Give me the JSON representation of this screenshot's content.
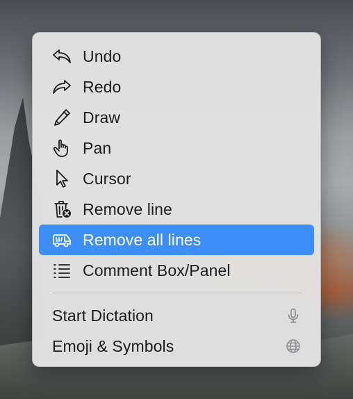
{
  "menu": {
    "items": [
      {
        "label": "Undo",
        "icon": "undo-arrow-icon",
        "selected": false
      },
      {
        "label": "Redo",
        "icon": "redo-arrow-icon",
        "selected": false
      },
      {
        "label": "Draw",
        "icon": "pencil-icon",
        "selected": false
      },
      {
        "label": "Pan",
        "icon": "hand-pointer-icon",
        "selected": false
      },
      {
        "label": "Cursor",
        "icon": "cursor-arrow-icon",
        "selected": false
      },
      {
        "label": "Remove line",
        "icon": "trash-remove-icon",
        "selected": false
      },
      {
        "label": "Remove all lines",
        "icon": "truck-remove-all-icon",
        "selected": true
      },
      {
        "label": "Comment Box/Panel",
        "icon": "list-bullets-icon",
        "selected": false
      }
    ],
    "system_items": [
      {
        "label": "Start Dictation",
        "trailing_icon": "microphone-icon"
      },
      {
        "label": "Emoji & Symbols",
        "trailing_icon": "globe-icon"
      }
    ]
  },
  "colors": {
    "menu_background": "#e2e2e2",
    "selection": "#3d8ef8",
    "text": "#1c1c1e",
    "trailing_icon": "#8e8e93"
  }
}
